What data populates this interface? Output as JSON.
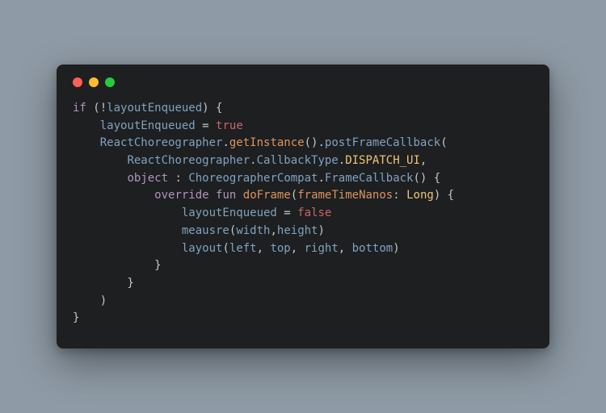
{
  "window": {
    "traffic_lights": [
      "close",
      "minimize",
      "zoom"
    ]
  },
  "code": {
    "language": "kotlin",
    "tokens": [
      [
        {
          "t": "kw",
          "v": "if"
        },
        {
          "t": "punc",
          "v": " (!"
        },
        {
          "t": "id",
          "v": "layoutEnqueued"
        },
        {
          "t": "punc",
          "v": ") {"
        }
      ],
      [
        {
          "t": "punc",
          "v": "    "
        },
        {
          "t": "id",
          "v": "layoutEnqueued"
        },
        {
          "t": "op",
          "v": " = "
        },
        {
          "t": "bool",
          "v": "true"
        }
      ],
      [
        {
          "t": "punc",
          "v": "    "
        },
        {
          "t": "id",
          "v": "ReactChoreographer"
        },
        {
          "t": "punc",
          "v": "."
        },
        {
          "t": "meth",
          "v": "getInstance"
        },
        {
          "t": "punc",
          "v": "()."
        },
        {
          "t": "call",
          "v": "postFrameCallback"
        },
        {
          "t": "punc",
          "v": "("
        }
      ],
      [
        {
          "t": "punc",
          "v": "        "
        },
        {
          "t": "id",
          "v": "ReactChoreographer"
        },
        {
          "t": "punc",
          "v": "."
        },
        {
          "t": "id",
          "v": "CallbackType"
        },
        {
          "t": "punc",
          "v": "."
        },
        {
          "t": "const",
          "v": "DISPATCH_UI"
        },
        {
          "t": "punc",
          "v": ","
        }
      ],
      [
        {
          "t": "punc",
          "v": "        "
        },
        {
          "t": "kw",
          "v": "object"
        },
        {
          "t": "punc",
          "v": " : "
        },
        {
          "t": "id",
          "v": "ChoreographerCompat"
        },
        {
          "t": "punc",
          "v": "."
        },
        {
          "t": "call",
          "v": "FrameCallback"
        },
        {
          "t": "punc",
          "v": "() {"
        }
      ],
      [
        {
          "t": "punc",
          "v": "            "
        },
        {
          "t": "kw",
          "v": "override"
        },
        {
          "t": "punc",
          "v": " "
        },
        {
          "t": "kw",
          "v": "fun"
        },
        {
          "t": "punc",
          "v": " "
        },
        {
          "t": "meth",
          "v": "doFrame"
        },
        {
          "t": "punc",
          "v": "("
        },
        {
          "t": "param",
          "v": "frameTimeNanos"
        },
        {
          "t": "punc",
          "v": ": "
        },
        {
          "t": "type",
          "v": "Long"
        },
        {
          "t": "punc",
          "v": ") {"
        }
      ],
      [
        {
          "t": "punc",
          "v": "                "
        },
        {
          "t": "id",
          "v": "layoutEnqueued"
        },
        {
          "t": "op",
          "v": " = "
        },
        {
          "t": "bool",
          "v": "false"
        }
      ],
      [
        {
          "t": "punc",
          "v": "                "
        },
        {
          "t": "call",
          "v": "meausre"
        },
        {
          "t": "punc",
          "v": "("
        },
        {
          "t": "id",
          "v": "width"
        },
        {
          "t": "punc",
          "v": ","
        },
        {
          "t": "id",
          "v": "height"
        },
        {
          "t": "punc",
          "v": ")"
        }
      ],
      [
        {
          "t": "punc",
          "v": "                "
        },
        {
          "t": "call",
          "v": "layout"
        },
        {
          "t": "punc",
          "v": "("
        },
        {
          "t": "id",
          "v": "left"
        },
        {
          "t": "punc",
          "v": ", "
        },
        {
          "t": "id",
          "v": "top"
        },
        {
          "t": "punc",
          "v": ", "
        },
        {
          "t": "id",
          "v": "right"
        },
        {
          "t": "punc",
          "v": ", "
        },
        {
          "t": "id",
          "v": "bottom"
        },
        {
          "t": "punc",
          "v": ")"
        }
      ],
      [
        {
          "t": "punc",
          "v": "            }"
        }
      ],
      [
        {
          "t": "punc",
          "v": "        }"
        }
      ],
      [
        {
          "t": "punc",
          "v": "    )"
        }
      ],
      [
        {
          "t": "punc",
          "v": "}"
        }
      ]
    ]
  }
}
